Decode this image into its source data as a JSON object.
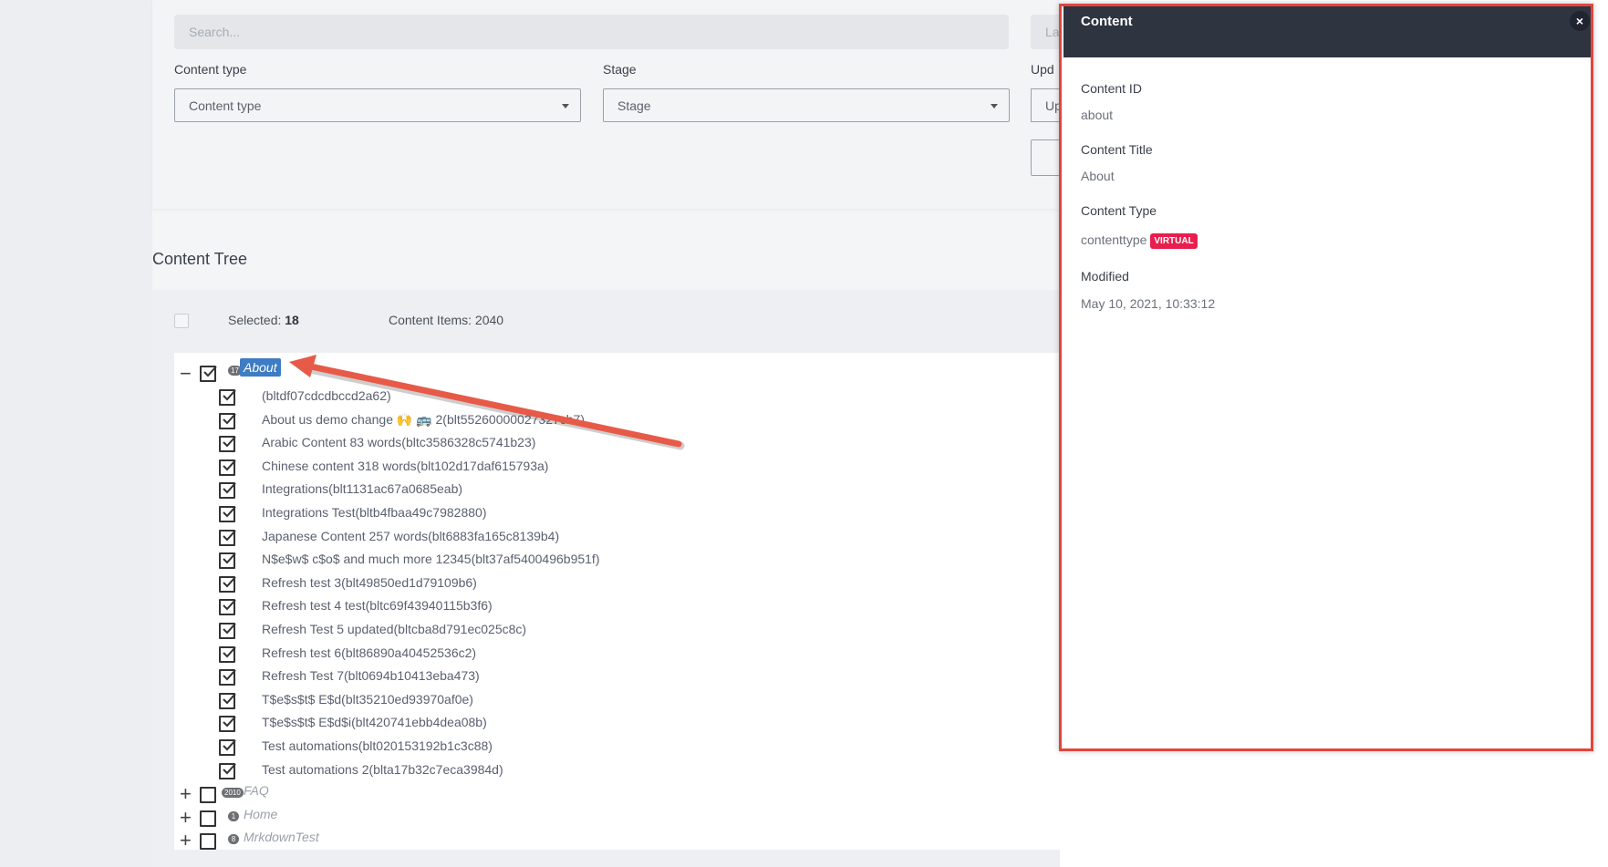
{
  "filters": {
    "search_placeholder": "Search...",
    "right_search_partial": "La",
    "content_type_label": "Content type",
    "content_type_value": "Content type",
    "stage_label": "Stage",
    "stage_value": "Stage",
    "updated_label_partial": "Upd",
    "updated_value_partial": "Up"
  },
  "tree": {
    "title": "Content Tree",
    "selected_label": "Selected:",
    "selected_count": "18",
    "content_items_label": "Content Items: 2040",
    "root": {
      "label": "About",
      "badge": "17"
    },
    "children": [
      "(bltdf07cdcdbccd2a62)",
      "About us demo change 🙌 🚌 2(blt55260000027327cb7)",
      "Arabic Content 83 words(bltc3586328c5741b23)",
      "Chinese content 318 words(blt102d17daf615793a)",
      "Integrations(blt1131ac67a0685eab)",
      "Integrations Test(bltb4fbaa49c7982880)",
      "Japanese Content 257 words(blt6883fa165c8139b4)",
      "N$e$w$ c$o$ and much more 12345(blt37af5400496b951f)",
      "Refresh test 3(blt49850ed1d79109b6)",
      "Refresh test 4 test(bltc69f43940115b3f6)",
      "Refresh Test 5 updated(bltcba8d791ec025c8c)",
      "Refresh test 6(blt86890a40452536c2)",
      "Refresh Test 7(blt0694b10413eba473)",
      "T$e$s$t$ E$d(blt35210ed93970af0e)",
      "T$e$s$t$ E$d$i(blt420741ebb4dea08b)",
      "Test automations(blt020153192b1c3c88)",
      "Test automations 2(blta17b32c7eca3984d)"
    ],
    "collapsed": [
      {
        "label": "FAQ",
        "badge": "2010"
      },
      {
        "label": "Home",
        "badge": "1"
      },
      {
        "label": "MrkdownTest",
        "badge": "8"
      }
    ]
  },
  "panel": {
    "title": "Content",
    "close_symbol": "×",
    "content_id_label": "Content ID",
    "content_id_value": "about",
    "content_title_label": "Content Title",
    "content_title_value": "About",
    "content_type_label": "Content Type",
    "content_type_value": "contenttype",
    "content_type_badge": "VIRTUAL",
    "modified_label": "Modified",
    "modified_value": "May 10, 2021, 10:33:12"
  },
  "colors": {
    "annotation_red": "#e0463c",
    "panel_header": "#2e3440",
    "virtual_badge": "#e81e4f",
    "selected_node": "#3e7cc4"
  }
}
